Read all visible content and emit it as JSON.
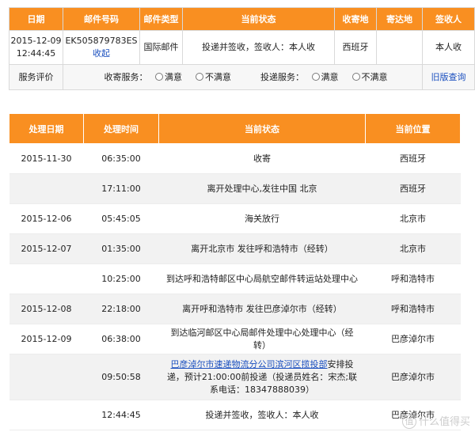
{
  "summary": {
    "headers": [
      "日期",
      "邮件号码",
      "邮件类型",
      "当前状态",
      "收寄地",
      "寄达地",
      "签收人"
    ],
    "row": {
      "date": "2015-12-09 12:44:45",
      "mail_no": "EK505879783ES",
      "collapse_link": "收起",
      "type": "国际邮件",
      "status": "投递并签收，签收人：本人收",
      "origin": "西班牙",
      "destination": "",
      "signer": "本人收"
    },
    "rating": {
      "label": "服务评价",
      "collect_label": "收寄服务：",
      "deliver_label": "投递服务：",
      "satisfied": "满意",
      "unsatisfied": "不满意",
      "old_version_link": "旧版查询"
    }
  },
  "tracking": {
    "headers": [
      "处理日期",
      "处理时间",
      "当前状态",
      "当前位置"
    ],
    "rows": [
      {
        "date": "2015-11-30",
        "time": "06:35:00",
        "status": "收寄",
        "location": "西班牙"
      },
      {
        "date": "",
        "time": "17:11:00",
        "status": "离开处理中心,发往中国 北京",
        "location": "西班牙"
      },
      {
        "date": "2015-12-06",
        "time": "05:45:05",
        "status": "海关放行",
        "location": "北京市"
      },
      {
        "date": "2015-12-07",
        "time": "01:35:00",
        "status": "离开北京市 发往呼和浩特市（经转）",
        "location": "北京市"
      },
      {
        "date": "",
        "time": "10:25:00",
        "status": "到达呼和浩特邮区中心局航空邮件转运站处理中心",
        "location": "呼和浩特市"
      },
      {
        "date": "2015-12-08",
        "time": "22:18:00",
        "status": "离开呼和浩特市 发往巴彦淖尔市（经转）",
        "location": "呼和浩特市"
      },
      {
        "date": "2015-12-09",
        "time": "06:38:00",
        "status": "到达临河邮区中心局邮件处理中心处理中心（经转）",
        "location": "巴彦淖尔市"
      },
      {
        "date": "",
        "time": "09:50:58",
        "status_link": "巴彦淖尔市速递物流分公司滨河区揽投部",
        "status": "安排投递，预计21:00:00前投递（投递员姓名：宋杰;联系电话：18347888039）",
        "location": "巴彦淖尔市"
      },
      {
        "date": "",
        "time": "12:44:45",
        "status": "投递并签收，签收人：本人收",
        "location": "巴彦淖尔市"
      }
    ]
  },
  "watermark": {
    "glyph": "值",
    "text": "什么值得买"
  }
}
